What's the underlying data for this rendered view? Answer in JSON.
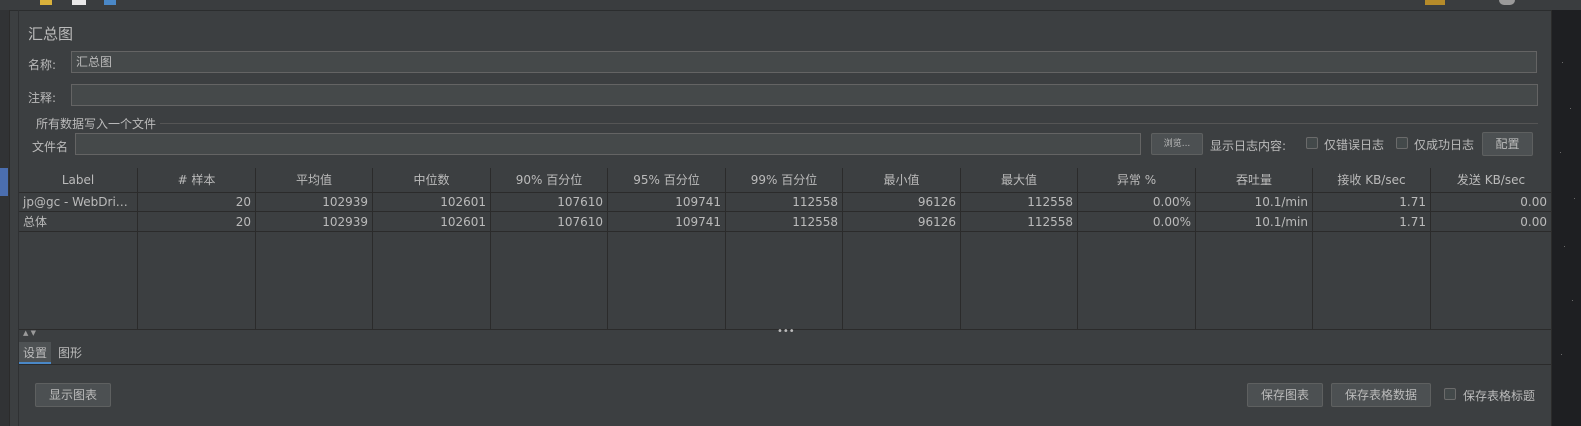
{
  "window": {
    "panel_title": "汇总图"
  },
  "form": {
    "name_label": "名称:",
    "name_value": "汇总图",
    "comment_label": "注释:",
    "comment_value": "",
    "group_title": "所有数据写入一个文件",
    "file_label": "文件名",
    "file_value": "",
    "browse_label": "浏览...",
    "log_content_label": "显示日志内容:",
    "errors_only_label": "仅错误日志",
    "success_only_label": "仅成功日志",
    "configure_label": "配置"
  },
  "table": {
    "headers": [
      "Label",
      "# 样本",
      "平均值",
      "中位数",
      "90% 百分位",
      "95% 百分位",
      "99% 百分位",
      "最小值",
      "最大值",
      "异常 %",
      "吞吐量",
      "接收 KB/sec",
      "发送 KB/sec"
    ],
    "rows": [
      [
        "jp@gc - WebDrive...",
        "20",
        "102939",
        "102601",
        "107610",
        "109741",
        "112558",
        "96126",
        "112558",
        "0.00%",
        "10.1/min",
        "1.71",
        "0.00"
      ],
      [
        "总体",
        "20",
        "102939",
        "102601",
        "107610",
        "109741",
        "112558",
        "96126",
        "112558",
        "0.00%",
        "10.1/min",
        "1.71",
        "0.00"
      ]
    ]
  },
  "tabs": {
    "settings": "设置",
    "graph": "图形"
  },
  "footer": {
    "show_chart": "显示图表",
    "save_chart": "保存图表",
    "save_table": "保存表格数据",
    "save_header": "保存表格标题"
  },
  "colors": {
    "background": "#3c3f41",
    "text": "#bbbbbb",
    "accent": "#4a88c7"
  }
}
